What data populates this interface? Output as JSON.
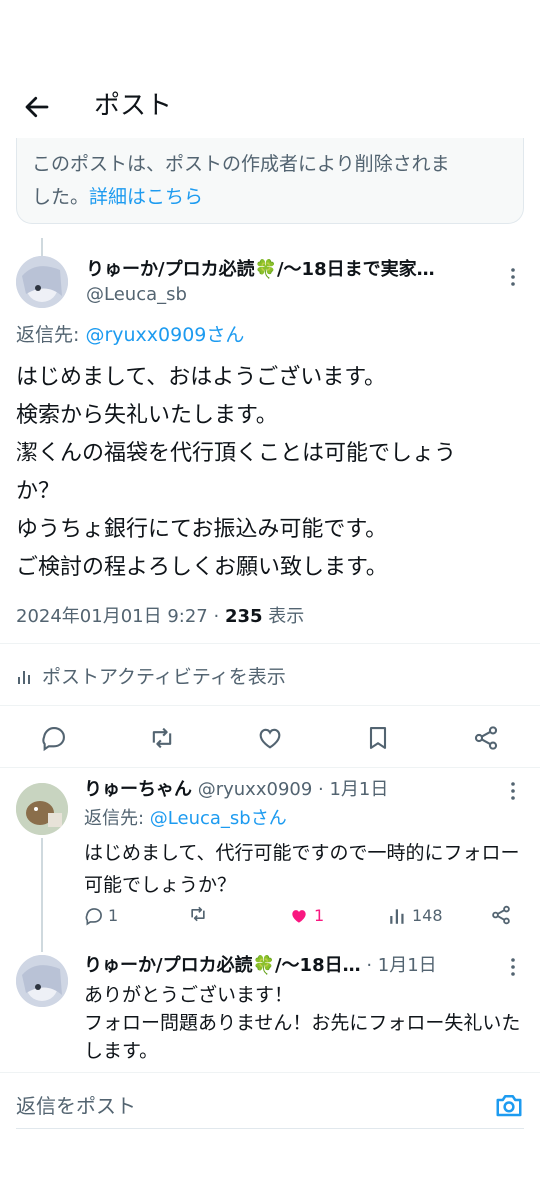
{
  "header": {
    "title": "ポスト"
  },
  "deleted_notice": {
    "text": "このポストは、ポストの作成者により削除されま",
    "text2": "した。",
    "link": "詳細はこちら"
  },
  "main_post": {
    "display_name": "りゅーか/プロカ必読🍀/〜18日まで実家…",
    "handle": "@Leuca_sb",
    "reply_label": "返信先: ",
    "reply_mention": "@ryuxx0909さん",
    "lines": [
      "はじめまして、おはようございます。",
      "検索から失礼いたします。",
      "潔くんの福袋を代行頂くことは可能でしょう",
      "か？",
      "ゆうちょ銀行にてお振込み可能です。",
      "ご検討の程よろしくお願い致します。"
    ],
    "timestamp": "2024年01月01日 9:27 · ",
    "views": "235",
    "views_label": " 表示",
    "activity": "ポストアクティビティを表示"
  },
  "reply1": {
    "display_name": "りゅーちゃん",
    "meta": " @ryuxx0909 · 1月1日",
    "reply_label": "返信先: ",
    "reply_mention": "@Leuca_sbさん",
    "text": "はじめまして、代行可能ですので一時的にフォロー可能でしょうか？",
    "replies": "1",
    "likes": "1",
    "views": "148"
  },
  "reply2": {
    "display_name": "りゅーか/プロカ必読🍀/〜18日…",
    "meta": " · 1月1日",
    "text1": "ありがとうございます！",
    "text2": "フォロー問題ありません！お先にフォロー失礼いたします。"
  },
  "composer": {
    "placeholder": "返信をポスト"
  },
  "colors": {
    "accent": "#1d9bf0",
    "like": "#f91880",
    "muted": "#536471"
  }
}
